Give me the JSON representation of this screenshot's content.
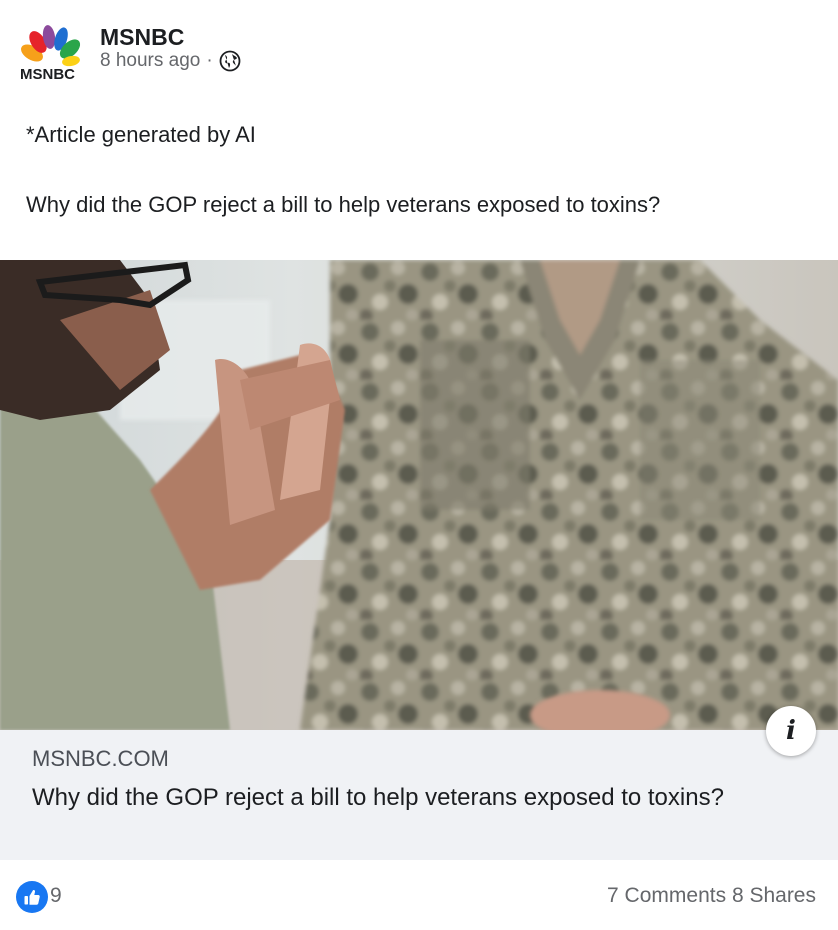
{
  "post": {
    "page_name": "MSNBC",
    "logo_text": "MSNBC",
    "timestamp": "8 hours ago",
    "separator": "·",
    "audience_icon": "globe-icon",
    "text_line1": "*Article generated by AI",
    "text_line2": "Why did the GOP reject a bill to help veterans exposed to toxins?"
  },
  "link_preview": {
    "image_description_icon": "info-icon",
    "info_glyph": "i",
    "domain": "MSNBC.COM",
    "title": "Why did the GOP reject a bill to help veterans exposed to toxins?"
  },
  "footer": {
    "reaction_icon": "like-icon",
    "like_count": "9",
    "comments": "7 Comments",
    "shares": "8 Shares"
  },
  "colors": {
    "facebook_blue": "#1877f2",
    "secondary_text": "#65676b",
    "link_box_bg": "#f0f2f5"
  }
}
